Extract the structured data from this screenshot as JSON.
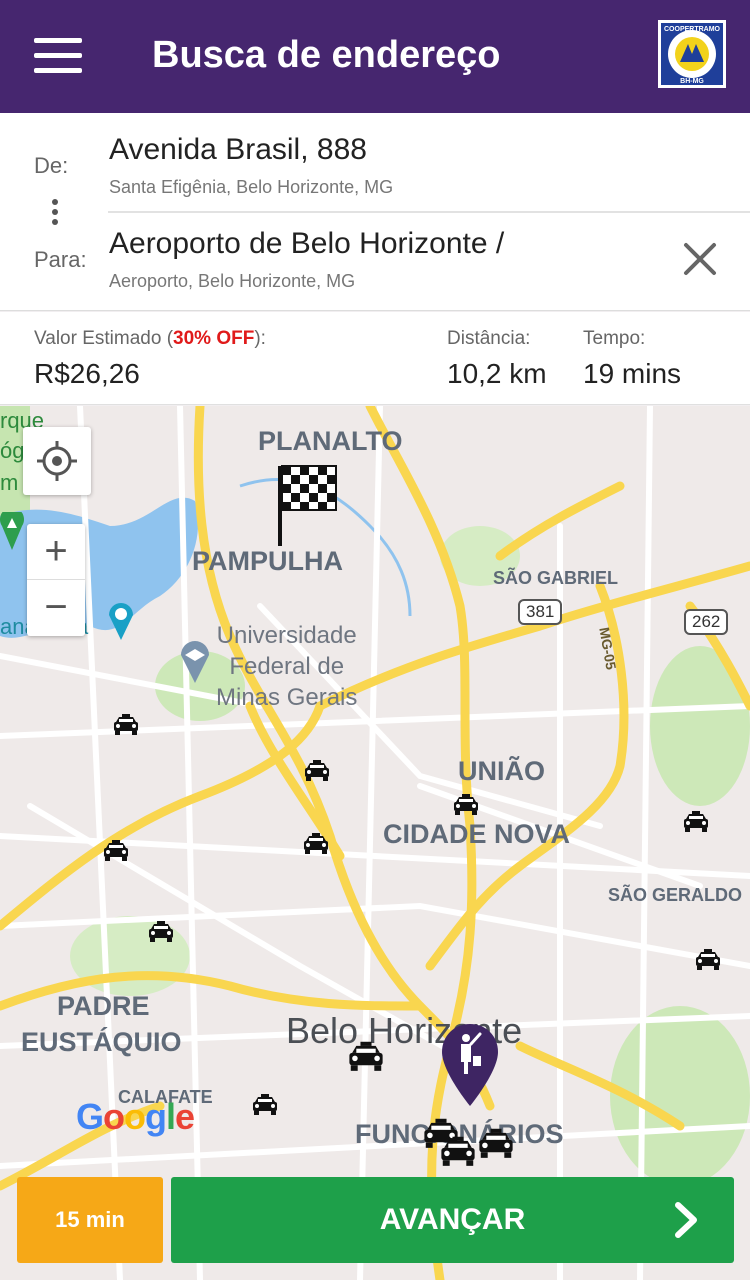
{
  "header": {
    "title": "Busca de endereço",
    "menu_icon": "hamburger-menu-icon",
    "logo_text_top": "COOPERTRAMO",
    "logo_text_bottom": "BH-MG"
  },
  "route": {
    "from_label": "De:",
    "from_main": "Avenida Brasil, 888",
    "from_sub": "Santa Efigênia, Belo Horizonte, MG",
    "to_label": "Para:",
    "to_main": "Aeroporto de Belo Horizonte /",
    "to_sub": "Aeroporto, Belo Horizonte, MG"
  },
  "estimate": {
    "price_label_prefix": "Valor Estimado (",
    "discount": "30% OFF",
    "price_label_suffix": "):",
    "price": "R$26,26",
    "distance_label": "Distância:",
    "distance": "10,2 km",
    "time_label": "Tempo:",
    "time": "19 mins"
  },
  "map": {
    "districts": {
      "planalto": "PLANALTO",
      "pampulha": "PAMPULHA",
      "uniao": "UNIÃO",
      "cidade_nova": "CIDADE NOVA",
      "padre": "PADRE",
      "eustaquio": "EUSTÁQUIO",
      "funcionarios": "FUNCIONÁRIOS",
      "sao_gabriel": "SÃO GABRIEL",
      "sao_geraldo": "SÃO GERALDO",
      "calafate": "CALAFATE"
    },
    "university_line1": "Universidade",
    "university_line2": "Federal de",
    "university_line3": "Minas Gerais",
    "city": "Belo Horizonte",
    "shield_381": "381",
    "shield_262": "262",
    "road_mg05": "MG-05",
    "park_partial_1": "rque",
    "park_partial_2": "óg",
    "park_partial_3": "m",
    "lake_partial": "ana",
    "lake_partial_2": "a",
    "zoom_in": "+",
    "zoom_out": "−",
    "google": "Google",
    "colors": {
      "road": "#f9d64f",
      "water": "#8fc3ee",
      "park": "#c6e5b0",
      "pin": "#3e2563"
    }
  },
  "footer": {
    "eta_button": "15 min",
    "next_button": "AVANÇAR"
  }
}
